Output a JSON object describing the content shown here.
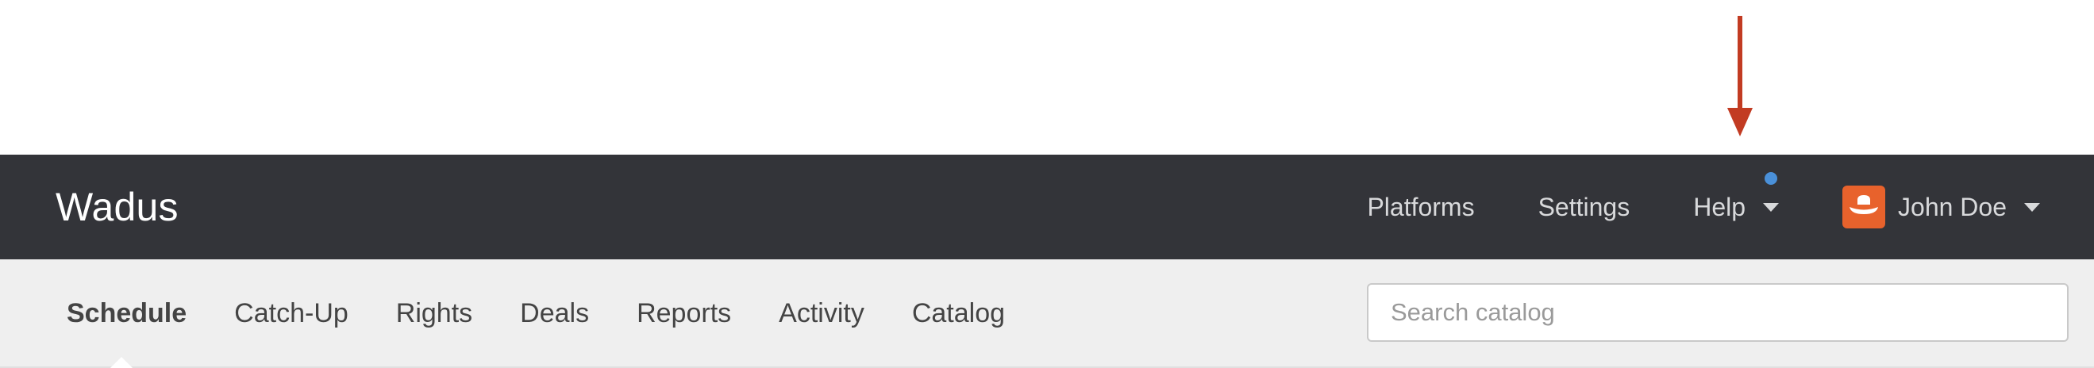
{
  "topbar": {
    "brand": "Wadus",
    "nav": {
      "platforms": "Platforms",
      "settings": "Settings",
      "help": "Help",
      "user_name": "John Doe"
    }
  },
  "subnav": {
    "tabs": [
      {
        "label": "Schedule",
        "active": true
      },
      {
        "label": "Catch-Up",
        "active": false
      },
      {
        "label": "Rights",
        "active": false
      },
      {
        "label": "Deals",
        "active": false
      },
      {
        "label": "Reports",
        "active": false
      },
      {
        "label": "Activity",
        "active": false
      },
      {
        "label": "Catalog",
        "active": false
      }
    ],
    "search": {
      "placeholder": "Search catalog",
      "value": ""
    }
  },
  "annotation": {
    "icon": "down-arrow-icon",
    "color": "#c23b22"
  },
  "colors": {
    "topbar_bg": "#333439",
    "subnav_bg": "#efefef",
    "avatar_bg": "#e8622c",
    "notification_dot": "#4a90d9"
  },
  "icons": {
    "avatar": "hat-avatar-icon",
    "help_notification": "notification-dot-icon",
    "dropdown": "caret-down-icon"
  }
}
